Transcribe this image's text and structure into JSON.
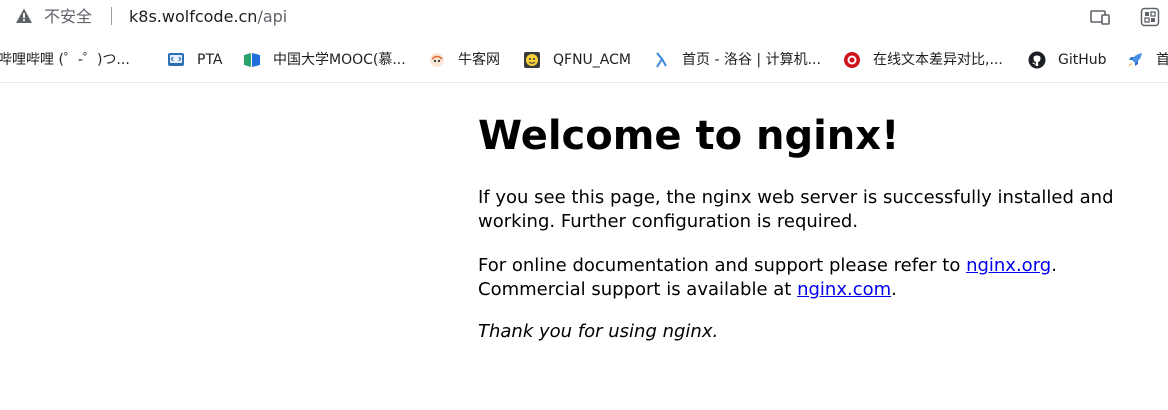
{
  "address_bar": {
    "security_label": "不安全",
    "url_host": "k8s.wolfcode.cn",
    "url_path": "/api",
    "warning_color": "#5f6368"
  },
  "bookmarks": [
    {
      "label": "哔哩哔哩 (゜-゜)つ...",
      "icon": "bilibili-icon"
    },
    {
      "label": "PTA",
      "icon": "pta-icon"
    },
    {
      "label": "中国大学MOOC(慕...",
      "icon": "mooc-icon"
    },
    {
      "label": "牛客网",
      "icon": "nowcoder-icon"
    },
    {
      "label": "QFNU_ACM",
      "icon": "qfnu-acm-icon"
    },
    {
      "label": "首页 - 洛谷 | 计算机...",
      "icon": "luogu-icon"
    },
    {
      "label": "在线文本差异对比,...",
      "icon": "text-diff-icon"
    },
    {
      "label": "GitHub",
      "icon": "github-icon"
    },
    {
      "label": "首",
      "icon": "rocket-icon"
    }
  ],
  "page": {
    "heading": "Welcome to nginx!",
    "p1": "If you see this page, the nginx web server is successfully installed and working. Further configuration is required.",
    "p2_prefix": "For online documentation and support please refer to ",
    "link_org": "nginx.org",
    "p2_mid": ".",
    "p2_line2": "Commercial support is available at ",
    "link_com": "nginx.com",
    "p2_end": ".",
    "p3": "Thank you for using nginx.",
    "link_color": "#0000ee"
  }
}
